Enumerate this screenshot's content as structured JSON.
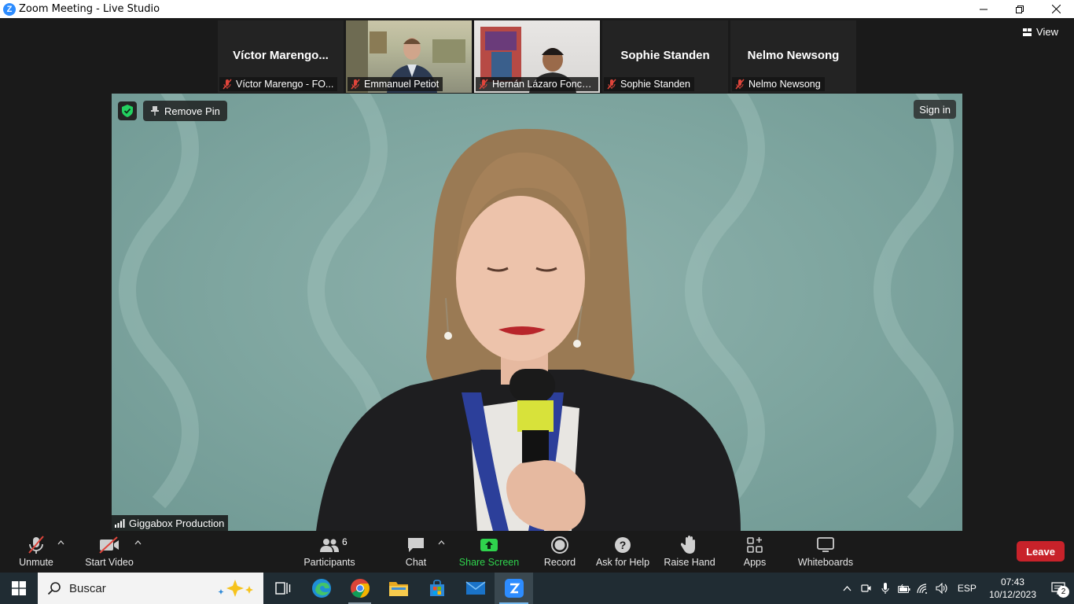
{
  "window": {
    "title": "Zoom Meeting - Live Studio",
    "controls": {
      "minimize": "—",
      "maximize": "❐",
      "close": "✕"
    }
  },
  "thumbnails": [
    {
      "display_name": "Víctor  Marengo...",
      "name_tag": "Víctor Marengo - FO...",
      "video": false
    },
    {
      "display_name": "",
      "name_tag": "Emmanuel Petiot",
      "video": true
    },
    {
      "display_name": "",
      "name_tag": "Hernán Lázaro Fonco...",
      "video": true
    },
    {
      "display_name": "Sophie Standen",
      "name_tag": "Sophie Standen",
      "video": false
    },
    {
      "display_name": "Nelmo Newsong",
      "name_tag": "Nelmo Newsong",
      "video": false
    }
  ],
  "view_button": "View",
  "main_video": {
    "remove_pin": "Remove Pin",
    "sign_in": "Sign in",
    "speaker_name": "Giggabox Production"
  },
  "toolbar": {
    "unmute": "Unmute",
    "start_video": "Start Video",
    "participants": "Participants",
    "participants_count": "6",
    "chat": "Chat",
    "share_screen": "Share Screen",
    "record": "Record",
    "ask_for_help": "Ask for Help",
    "raise_hand": "Raise Hand",
    "apps": "Apps",
    "whiteboards": "Whiteboards",
    "leave": "Leave",
    "colors": {
      "share_green": "#2fd34d",
      "leave_red": "#c8222a"
    }
  },
  "taskbar": {
    "search_placeholder": "Buscar",
    "apps": [
      "task-view",
      "edge",
      "chrome",
      "file-explorer",
      "microsoft-store",
      "mail",
      "zoom"
    ],
    "language": "ESP",
    "time": "07:43",
    "date": "10/12/2023",
    "notification_count": "2"
  }
}
